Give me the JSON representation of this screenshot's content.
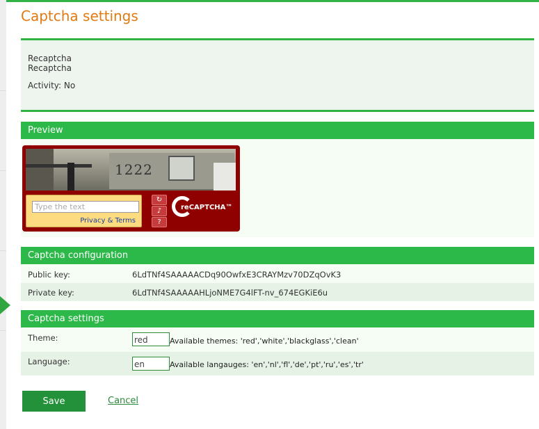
{
  "page": {
    "title": "Captcha settings"
  },
  "info": {
    "line1": "Recaptcha",
    "line2": "Recaptcha",
    "activity": "Activity: No"
  },
  "preview": {
    "header": "Preview",
    "captcha_number": "1222",
    "input_placeholder": "Type the text",
    "privacy_link": "Privacy & Terms",
    "buttons": [
      "refresh-icon",
      "audio-icon",
      "help-icon"
    ],
    "logo_text": "reCAPTCHA™"
  },
  "config": {
    "header": "Captcha configuration",
    "public_key_label": "Public key:",
    "public_key": "6LdTNf4SAAAAACDq90OwfxE3CRAYMzv70DZqOvK3",
    "private_key_label": "Private key:",
    "private_key": "6LdTNf4SAAAAAHLjoNME7G4lFT-nv_674EGKiE6u"
  },
  "settings": {
    "header": "Captcha settings",
    "theme_label": "Theme:",
    "theme_value": "red",
    "theme_hint": "Available themes: 'red','white','blackglass','clean'",
    "language_label": "Language:",
    "language_value": "en",
    "language_hint": "Available langauges: 'en','nl','fl','de','pt','ru','es','tr'"
  },
  "actions": {
    "save_label": "Save",
    "cancel_label": "Cancel"
  },
  "colors": {
    "accent_green": "#2db94a",
    "title_orange": "#e07a12",
    "captcha_red": "#8f0101"
  }
}
